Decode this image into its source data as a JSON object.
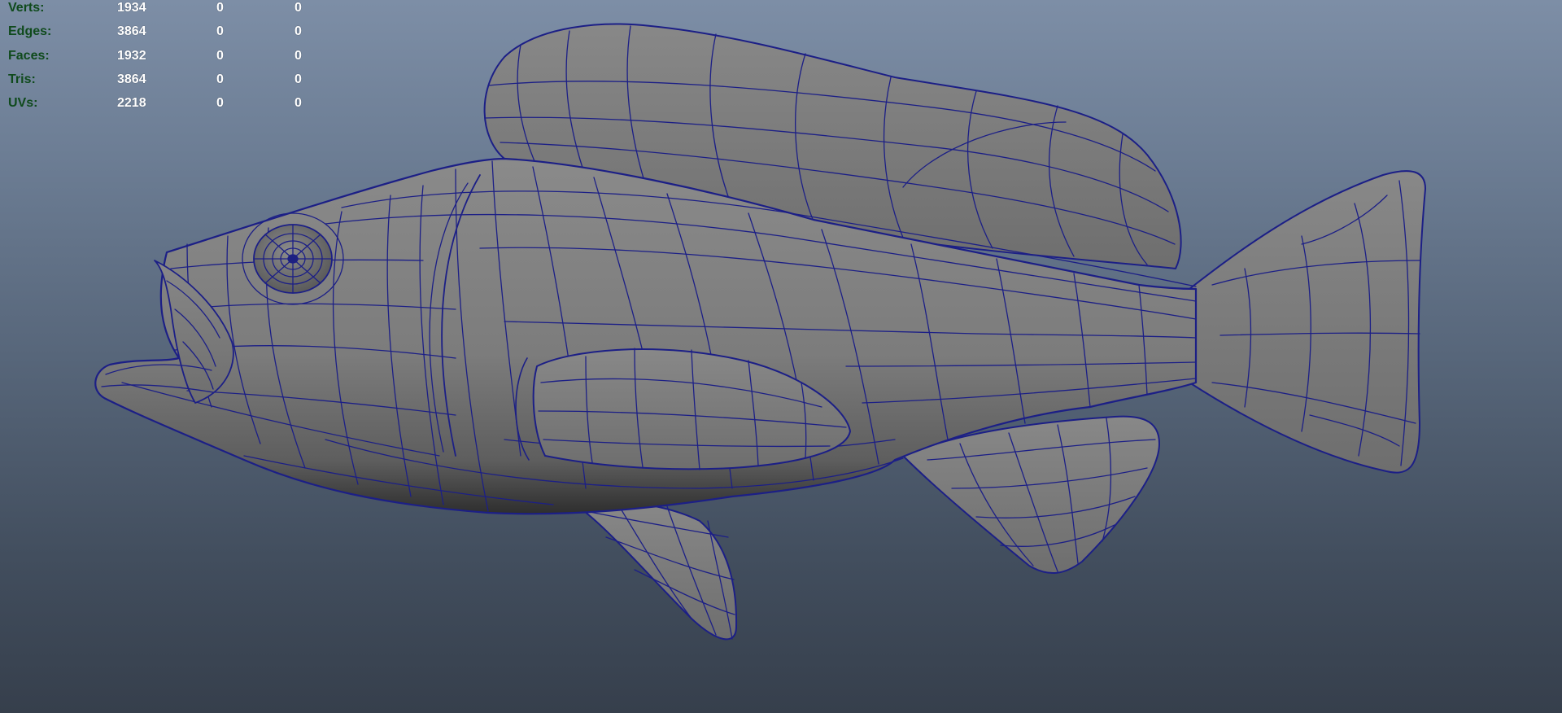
{
  "hud": {
    "rows": [
      {
        "label": "Verts:",
        "total": "1934",
        "selected": "0",
        "extra": "0"
      },
      {
        "label": "Edges:",
        "total": "3864",
        "selected": "0",
        "extra": "0"
      },
      {
        "label": "Faces:",
        "total": "1932",
        "selected": "0",
        "extra": "0"
      },
      {
        "label": "Tris:",
        "total": "3864",
        "selected": "0",
        "extra": "0"
      },
      {
        "label": "UVs:",
        "total": "2218",
        "selected": "0",
        "extra": "0"
      }
    ]
  },
  "colors": {
    "background_top": "#7d8ea6",
    "background_bottom": "#363f4c",
    "mesh_fill": "#7b7b7b",
    "wireframe": "#1c1f86",
    "hud_label": "#0f4a1c",
    "hud_value": "#ffffff"
  },
  "model": {
    "shading": "wireframe-on-shaded"
  }
}
